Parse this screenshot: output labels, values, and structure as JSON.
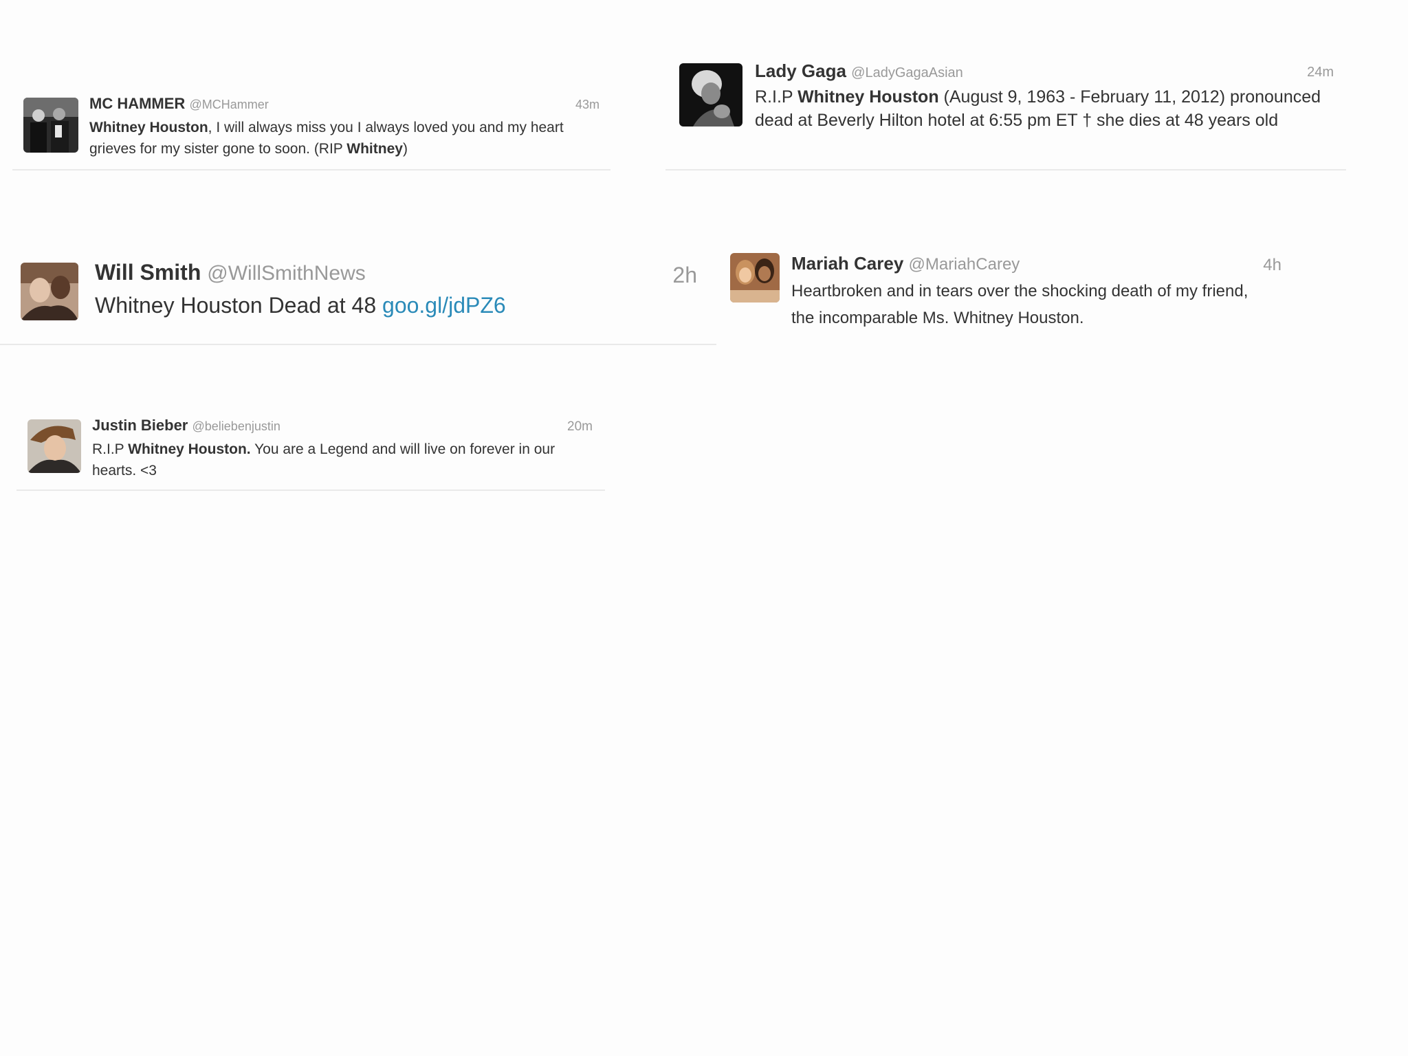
{
  "tweets": {
    "hammer": {
      "name": "MC HAMMER",
      "handle": "@MCHammer",
      "time": "43m",
      "body": [
        {
          "text": "Whitney Houston",
          "bold": true
        },
        {
          "text": ", I will always miss you I always loved you and my heart grieves for my sister gone to soon. (RIP ",
          "bold": false
        },
        {
          "text": "Whitney",
          "bold": true
        },
        {
          "text": ")",
          "bold": false
        }
      ],
      "avatar_icon": "avatar-photo-icon"
    },
    "gaga": {
      "name": "Lady Gaga",
      "handle": "@LadyGagaAsian",
      "time": "24m",
      "body": [
        {
          "text": "R.I.P ",
          "bold": false
        },
        {
          "text": "Whitney Houston",
          "bold": true
        },
        {
          "text": " (August 9, 1963 - February 11, 2012) pronounced dead at Beverly Hilton hotel at 6:55 pm ET † she dies at 48 years old",
          "bold": false
        }
      ],
      "avatar_icon": "avatar-photo-icon"
    },
    "smith": {
      "name": "Will Smith",
      "handle": "@WillSmithNews",
      "time": "2h",
      "body": [
        {
          "text": "Whitney Houston Dead at 48 ",
          "bold": false
        },
        {
          "text": "goo.gl/jdPZ6",
          "link": true
        }
      ],
      "avatar_icon": "avatar-photo-icon"
    },
    "mariah": {
      "name": "Mariah Carey",
      "handle": "@MariahCarey",
      "time": "4h",
      "body": [
        {
          "text": "Heartbroken and in tears over the shocking death of my friend, the incomparable Ms. Whitney Houston.",
          "bold": false
        }
      ],
      "avatar_icon": "avatar-photo-icon"
    },
    "bieber": {
      "name": "Justin Bieber",
      "handle": "@beliebenjustin",
      "time": "20m",
      "body": [
        {
          "text": "R.I.P ",
          "bold": false
        },
        {
          "text": "Whitney Houston.",
          "bold": true
        },
        {
          "text": " You are a Legend and will live on forever in our hearts. <3",
          "bold": false
        }
      ],
      "avatar_icon": "avatar-photo-icon"
    }
  },
  "colors": {
    "background": "#fdfdfd",
    "text": "#333333",
    "muted": "#999999",
    "link": "#2a8ab8",
    "divider": "#e9e9e9"
  }
}
